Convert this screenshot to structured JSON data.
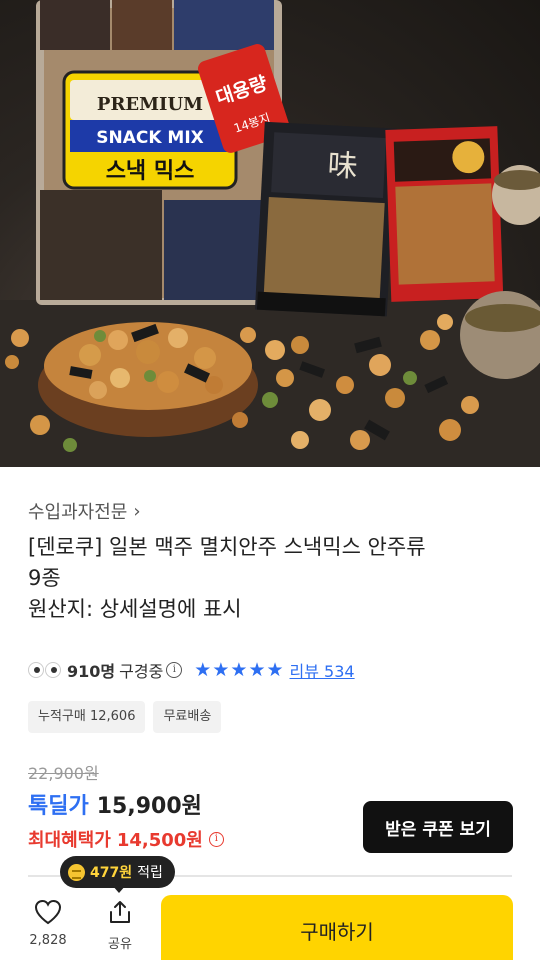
{
  "hero": {
    "bag_big": {
      "badge_line1": "PREMIUM",
      "badge_line2": "SNACK MIX",
      "badge_line3": "스낵 믹스",
      "ribbon_line1": "대용량",
      "ribbon_line2": "14봉지"
    },
    "colors": {
      "ribbon_red": "#d7261e",
      "badge_blue": "#1d3aa8",
      "badge_yellow": "#f5d400"
    }
  },
  "brand": {
    "label": "수입과자전문",
    "chevron_icon": "chevron-right-icon"
  },
  "product": {
    "title_line1": "[덴로쿠] 일본 맥주 멸치안주 스낵믹스 안주류",
    "title_line2": "9종",
    "origin": "원산지: 상세설명에 표시"
  },
  "stats": {
    "viewers_count": "910명",
    "viewers_suffix": "구경중",
    "stars": 5,
    "review_link": "리뷰 534"
  },
  "tags": [
    "누적구매 12,606",
    "무료배송"
  ],
  "price": {
    "original": "22,900원",
    "deal_label": "톡딜가",
    "deal_price": "15,900원",
    "max_label": "최대혜택가",
    "max_price": "14,500원"
  },
  "coupon_button": "받은 쿠폰 보기",
  "reward": {
    "amount": "477원",
    "suffix": "적립"
  },
  "bottom_bar": {
    "like_count": "2,828",
    "share_label": "공유",
    "buy_label": "구매하기"
  },
  "colors": {
    "accent_blue": "#2e6ff2",
    "accent_red": "#e83a2f",
    "buy_yellow": "#ffd400"
  }
}
